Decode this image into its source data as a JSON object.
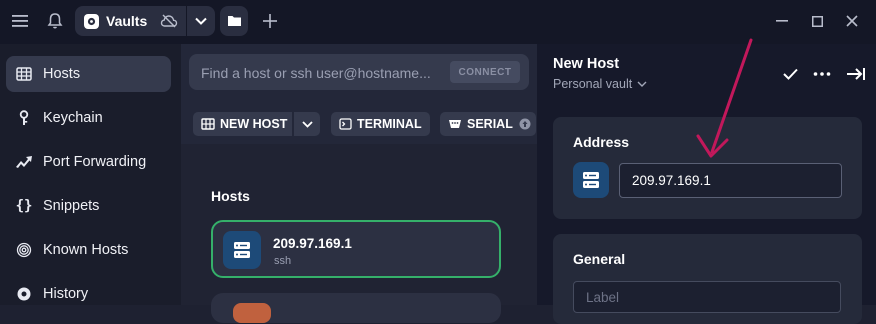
{
  "titlebar": {
    "vault_tab_label": "Vaults"
  },
  "sidebar": {
    "items": [
      {
        "label": "Hosts",
        "icon": "server-grid-icon",
        "active": true
      },
      {
        "label": "Keychain",
        "icon": "key-icon"
      },
      {
        "label": "Port Forwarding",
        "icon": "arrow-forward-icon"
      },
      {
        "label": "Snippets",
        "icon": "braces-icon"
      },
      {
        "label": "Known Hosts",
        "icon": "fingerprint-icon"
      },
      {
        "label": "History",
        "icon": "history-icon"
      }
    ]
  },
  "search": {
    "placeholder": "Find a host or ssh user@hostname...",
    "connect_label": "CONNECT"
  },
  "actions": {
    "new_host": "NEW HOST",
    "terminal": "TERMINAL",
    "serial": "SERIAL"
  },
  "hosts": {
    "section_title": "Hosts",
    "items": [
      {
        "title": "209.97.169.1",
        "subtitle": "ssh"
      }
    ]
  },
  "panel": {
    "title": "New Host",
    "vault": "Personal vault",
    "address_heading": "Address",
    "address_value": "209.97.169.1",
    "general_heading": "General",
    "label_placeholder": "Label"
  },
  "colors": {
    "accent_green": "#35b06a",
    "host_icon_bg": "#1d4a78",
    "annotation_arrow": "#c2185b"
  }
}
